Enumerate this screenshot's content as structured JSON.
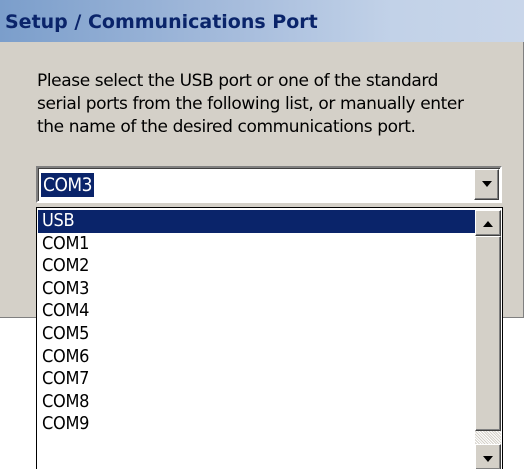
{
  "dialog": {
    "title": "Setup / Communications Port",
    "instructions": [
      "Please select the USB port or one of the standard",
      "serial ports from the following list, or manually enter",
      "the name of the desired communications port."
    ]
  },
  "combo": {
    "value": "COM3"
  },
  "dropdown": {
    "items": [
      "USB",
      "COM1",
      "COM2",
      "COM3",
      "COM4",
      "COM5",
      "COM6",
      "COM7",
      "COM8",
      "COM9"
    ],
    "selected": "USB"
  },
  "icons": {
    "combo_button": "chevron-down-icon",
    "scroll_up": "arrow-up-icon",
    "scroll_down": "arrow-down-icon"
  }
}
